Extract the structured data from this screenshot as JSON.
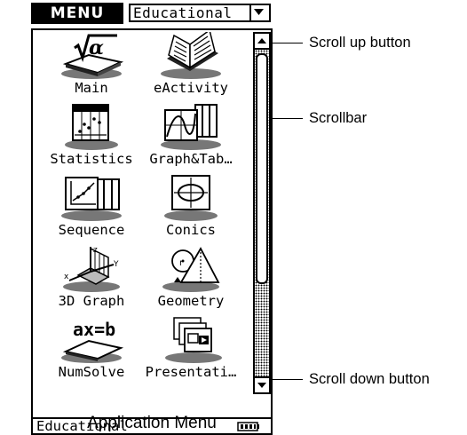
{
  "header": {
    "menu_label": "MENU",
    "category_value": "Educational"
  },
  "apps": [
    {
      "label": "Main",
      "icon": "sqrt-alpha-icon"
    },
    {
      "label": "eActivity",
      "icon": "open-book-icon"
    },
    {
      "label": "Statistics",
      "icon": "stats-list-icon"
    },
    {
      "label": "Graph&Tab…",
      "icon": "graph-table-icon"
    },
    {
      "label": "Sequence",
      "icon": "sequence-icon"
    },
    {
      "label": "Conics",
      "icon": "conics-icon"
    },
    {
      "label": "3D Graph",
      "icon": "3d-graph-icon"
    },
    {
      "label": "Geometry",
      "icon": "geometry-icon"
    },
    {
      "label": "NumSolve",
      "icon": "numsolve-icon"
    },
    {
      "label": "Presentati…",
      "icon": "presentation-icon"
    }
  ],
  "status_bar": {
    "text": "Educational",
    "battery_icon": "battery-icon"
  },
  "callouts": {
    "scroll_up": "Scroll up button",
    "scrollbar": "Scrollbar",
    "scroll_down": "Scroll down button"
  },
  "caption": "Application Menu"
}
